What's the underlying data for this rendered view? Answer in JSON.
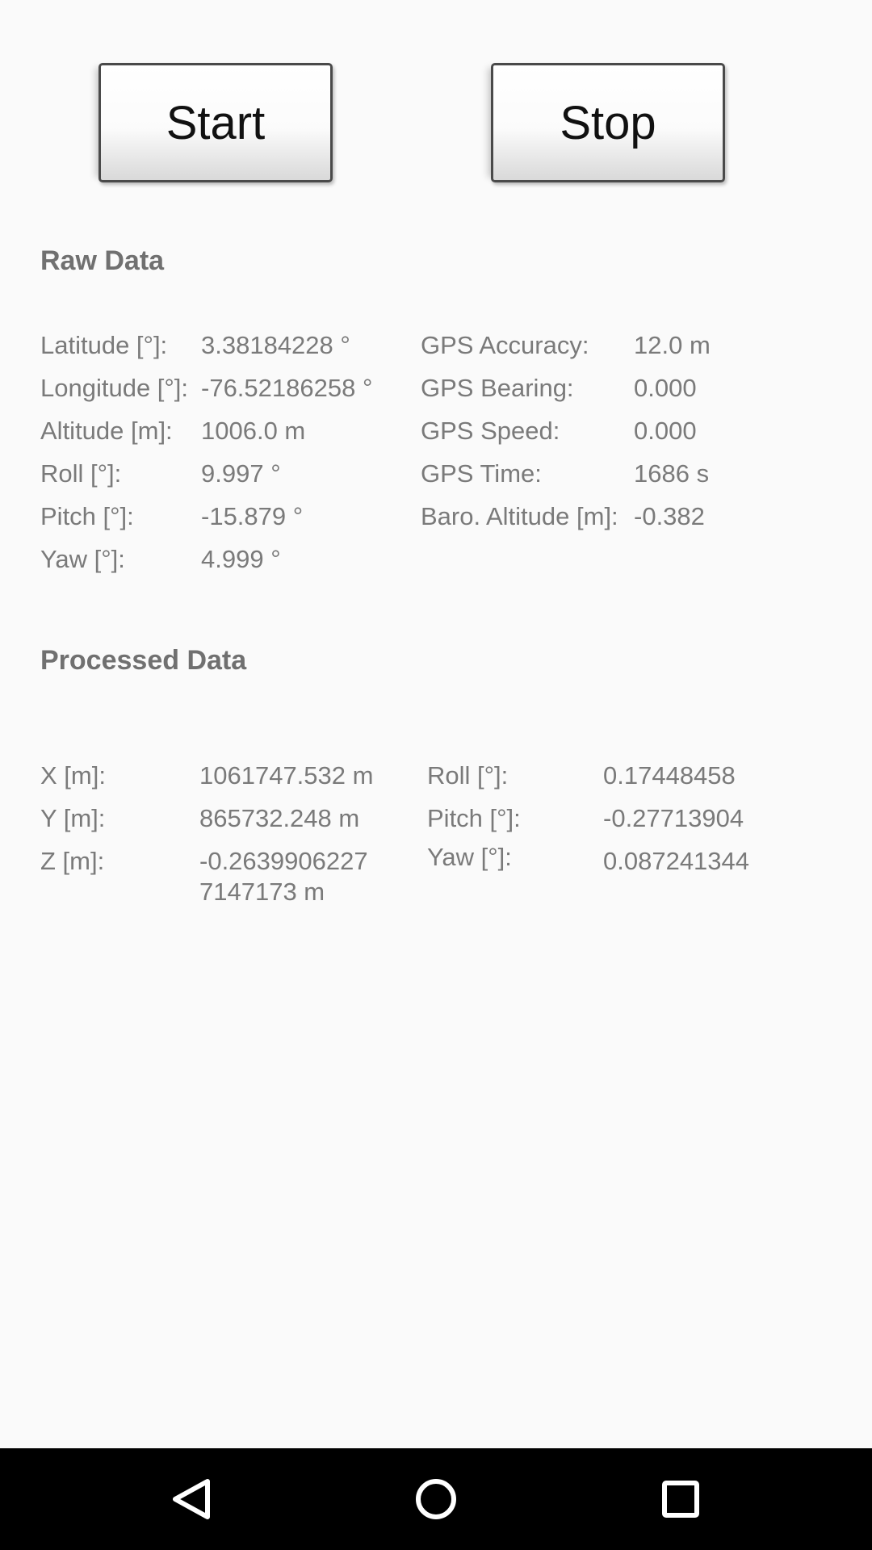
{
  "buttons": {
    "start": "Start",
    "stop": "Stop"
  },
  "raw": {
    "title": "Raw Data",
    "left": [
      {
        "label": "Latitude [°]:",
        "value": "3.38184228 °"
      },
      {
        "label": "Longitude [°]:",
        "value": "-76.52186258 °"
      },
      {
        "label": "Altitude [m]:",
        "value": "1006.0 m"
      },
      {
        "label": "Roll [°]:",
        "value": "9.997 °"
      },
      {
        "label": "Pitch [°]:",
        "value": "-15.879 °"
      },
      {
        "label": "Yaw [°]:",
        "value": "4.999 °"
      }
    ],
    "right": [
      {
        "label": "GPS Accuracy:",
        "value": "12.0 m"
      },
      {
        "label": "GPS Bearing:",
        "value": "0.000"
      },
      {
        "label": "GPS Speed:",
        "value": "0.000"
      },
      {
        "label": "GPS Time:",
        "value": "1686 s"
      },
      {
        "label": "Baro. Altitude [m]:",
        "value": "-0.382"
      }
    ]
  },
  "processed": {
    "title": "Processed Data",
    "left": [
      {
        "label": "X [m]:",
        "value": "1061747.532 m"
      },
      {
        "label": "Y [m]:",
        "value": "865732.248 m"
      },
      {
        "label": "Z [m]:",
        "value": "-0.26399062277147173 m"
      }
    ],
    "right": [
      {
        "label": "Roll [°]:",
        "value": "0.17448458"
      },
      {
        "label": "Pitch [°]:",
        "value": "-0.27713904"
      },
      {
        "label": "Yaw [°]:",
        "value": "0.087241344"
      }
    ]
  },
  "navbar": {
    "back": "back-icon",
    "home": "home-icon",
    "recents": "recents-icon"
  }
}
